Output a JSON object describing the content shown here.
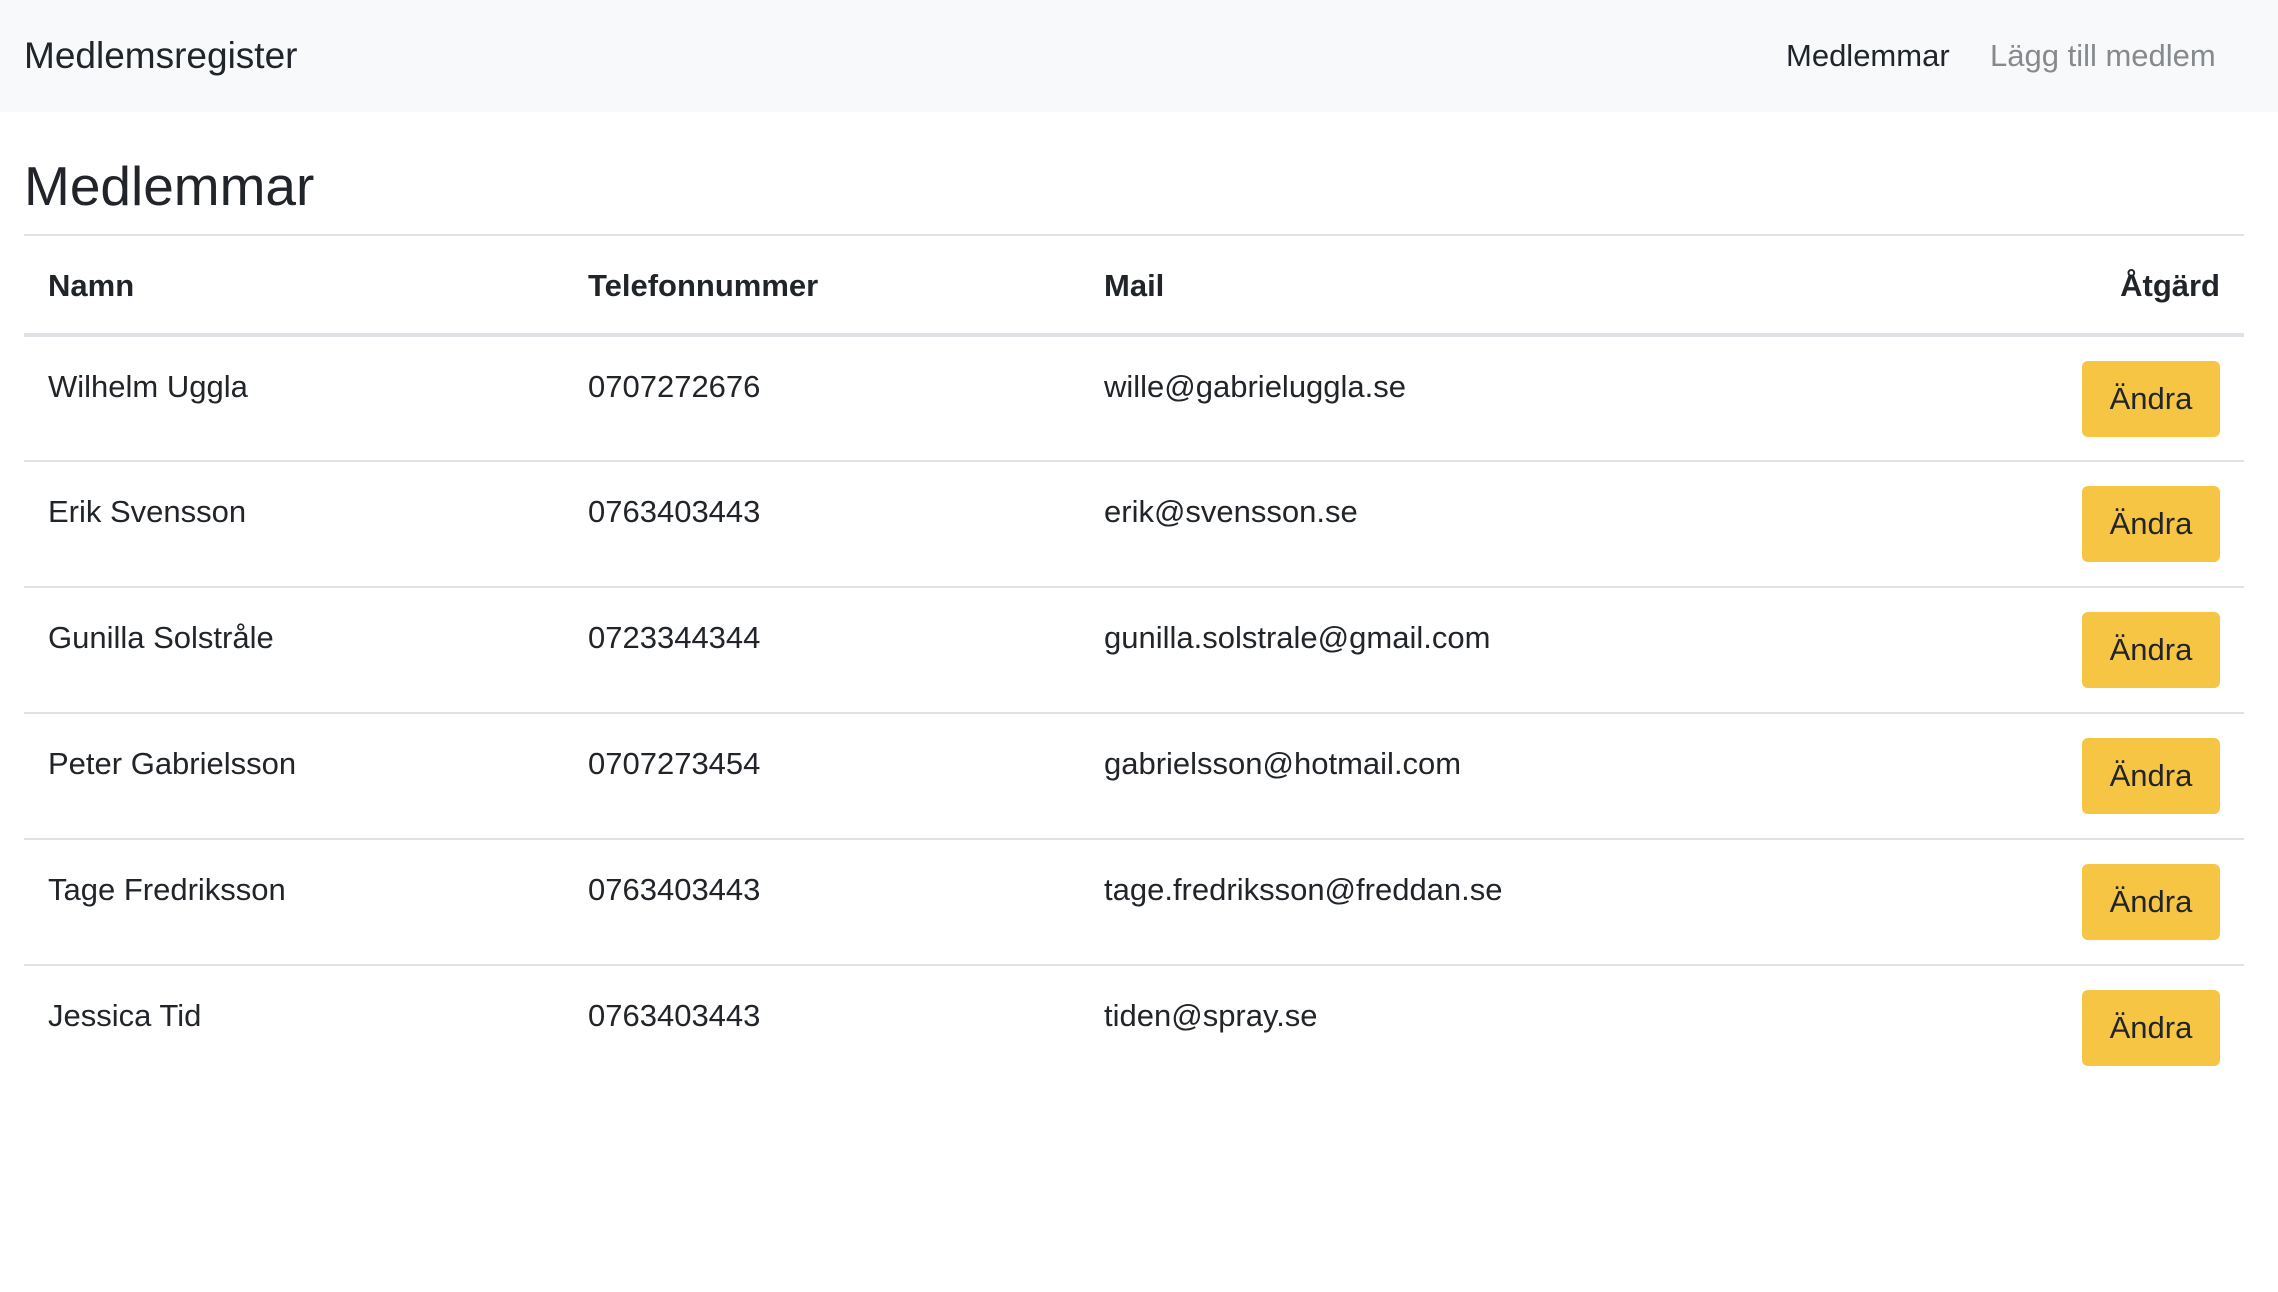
{
  "navbar": {
    "brand": "Medlemsregister",
    "links": [
      {
        "label": "Medlemmar",
        "active": true
      },
      {
        "label": "Lägg till medlem",
        "active": false
      }
    ]
  },
  "main": {
    "title": "Medlemmar",
    "table": {
      "headers": {
        "name": "Namn",
        "phone": "Telefonnummer",
        "mail": "Mail",
        "action": "Åtgärd"
      },
      "rows": [
        {
          "name": "Wilhelm Uggla",
          "phone": "0707272676",
          "mail": "wille@gabrieluggla.se",
          "action": "Ändra"
        },
        {
          "name": "Erik Svensson",
          "phone": "0763403443",
          "mail": "erik@svensson.se",
          "action": "Ändra"
        },
        {
          "name": "Gunilla Solstråle",
          "phone": "0723344344",
          "mail": "gunilla.solstrale@gmail.com",
          "action": "Ändra"
        },
        {
          "name": "Peter Gabrielsson",
          "phone": "0707273454",
          "mail": "gabrielsson@hotmail.com",
          "action": "Ändra"
        },
        {
          "name": "Tage Fredriksson",
          "phone": "0763403443",
          "mail": "tage.fredriksson@freddan.se",
          "action": "Ändra"
        },
        {
          "name": "Jessica Tid",
          "phone": "0763403443",
          "mail": "tiden@spray.se",
          "action": "Ändra"
        }
      ]
    }
  },
  "colors": {
    "navbar_bg": "#f8f9fa",
    "edit_button": "#f7c544",
    "text": "#212529",
    "inactive_link": "#878a8d",
    "border": "#dee2e6"
  }
}
